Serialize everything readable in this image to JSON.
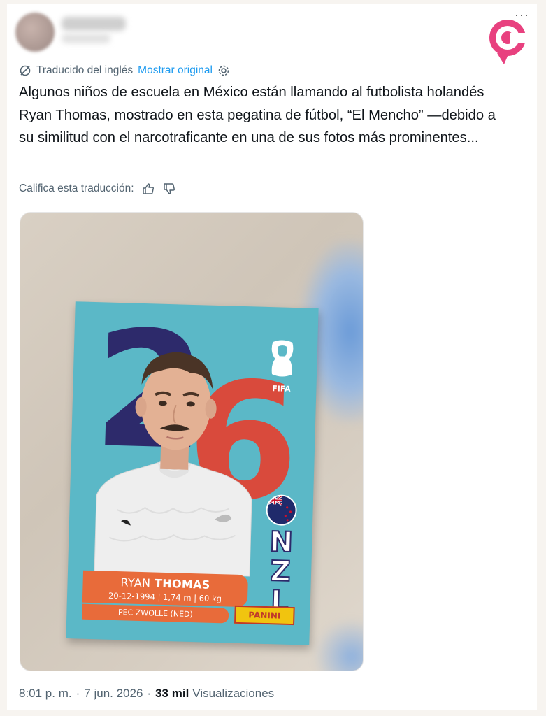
{
  "translation": {
    "label": "Traducido del inglés",
    "show_original": "Mostrar original"
  },
  "tweet": {
    "text": "Algunos niños de escuela en México están llamando al futbolista holandés Ryan Thomas, mostrado en esta pegatina de fútbol, “El Mencho” —debido a su similitud con el narcotraficante en una de sus fotos más prominentes..."
  },
  "rating": {
    "label": "Califica esta traducción:"
  },
  "sticker": {
    "year_digit_1": "2",
    "year_digit_2": "6",
    "fifa_label": "FIFA",
    "team_code": "NZL",
    "player_first_name": "RYAN",
    "player_last_name": "THOMAS",
    "stats": "20-12-1994 | 1,74 m | 60 kg",
    "club": "PEC ZWOLLE (NED)",
    "brand": "PANINI"
  },
  "footer": {
    "time": "8:01 p. m.",
    "date": "7 jun. 2026",
    "views_count": "33 mil",
    "views_label": "Visualizaciones",
    "separator": "·"
  },
  "colors": {
    "link": "#1d9bf0",
    "secondary_text": "#536471",
    "sticker_bg": "#5bb8c7",
    "banner": "#e86b3a",
    "brand_pink": "#e8417f"
  }
}
